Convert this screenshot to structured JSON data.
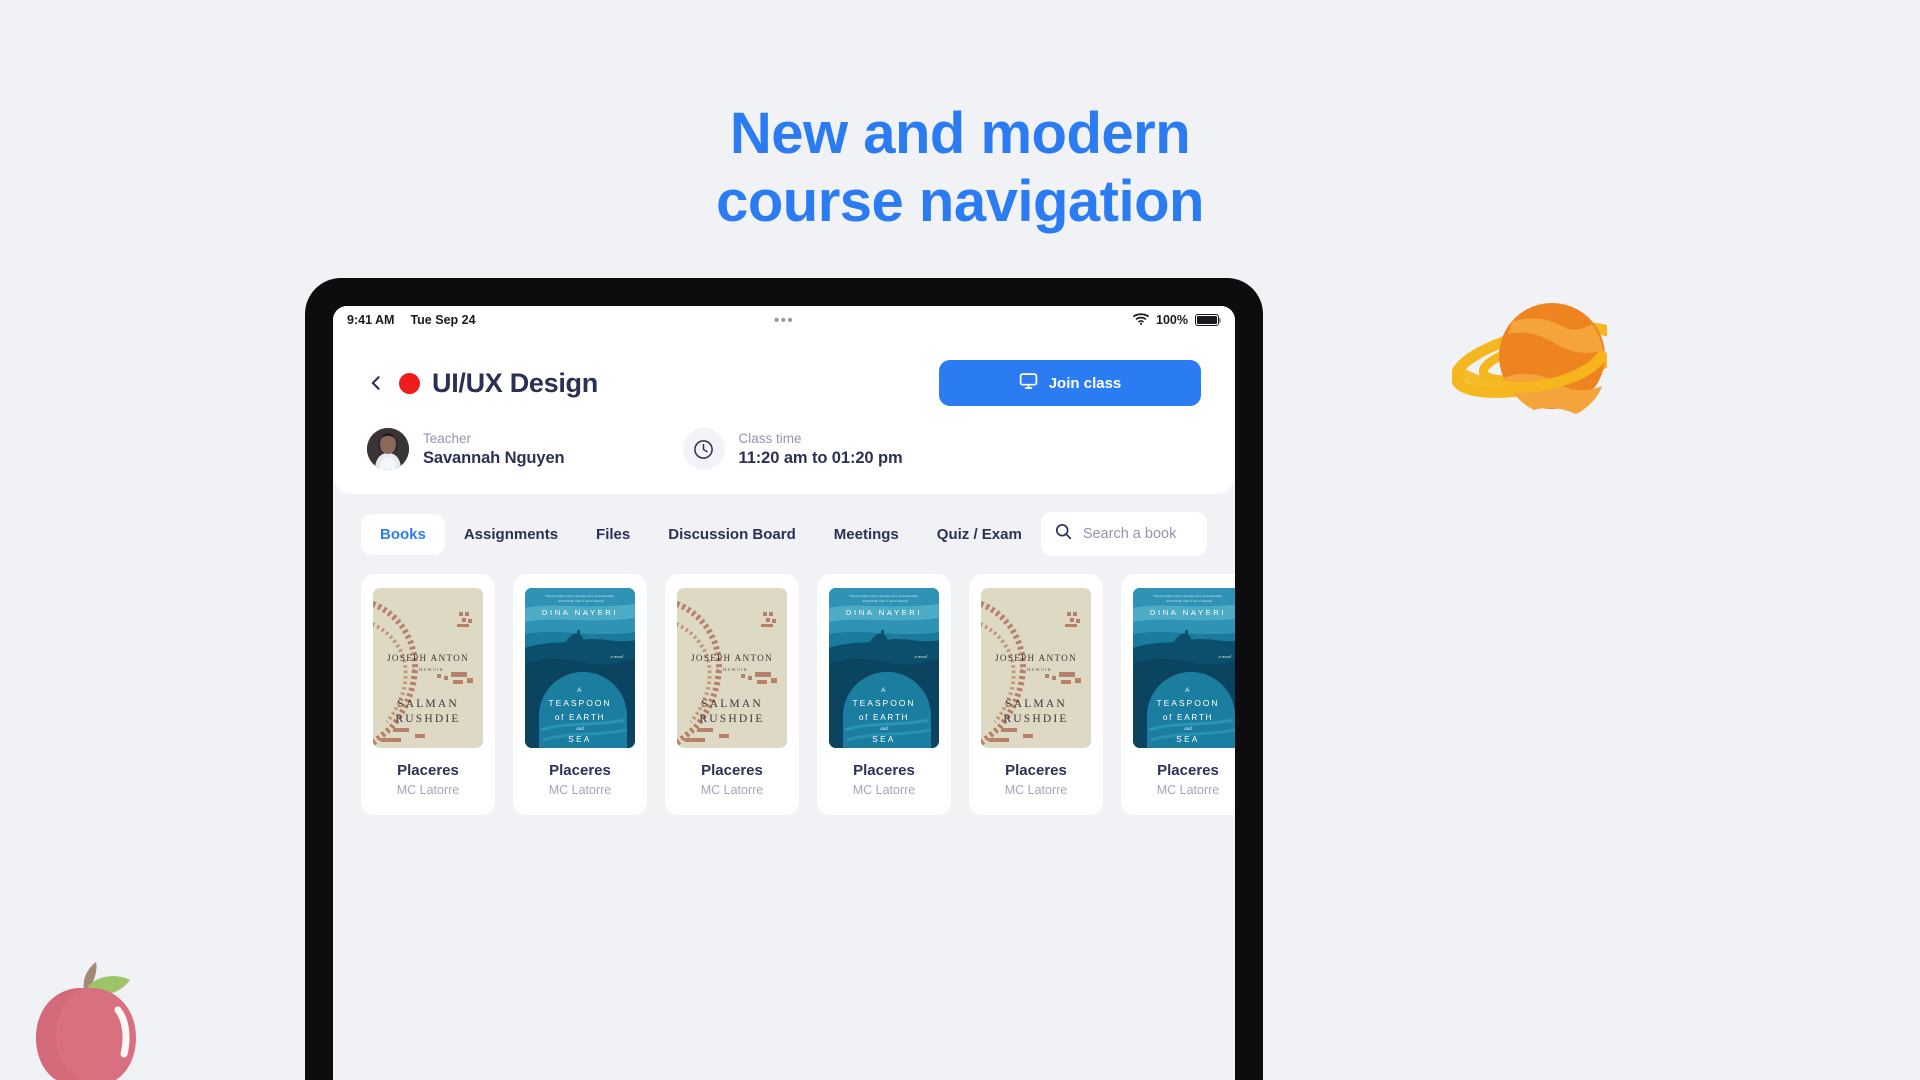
{
  "headline": {
    "line1": "New and modern",
    "line2": "course navigation",
    "color": "#2b7bf3"
  },
  "statusbar": {
    "time": "9:41 AM",
    "date": "Tue Sep 24",
    "dots": "•••",
    "wifi_icon": "wifi-icon",
    "battery_percent": "100%",
    "battery_icon": "battery-full-icon"
  },
  "course": {
    "back_icon": "chevron-left-icon",
    "status_dot_color": "#f01c1c",
    "title": "UI/UX Design",
    "join_button": {
      "label": "Join class",
      "icon": "presentation-screen-icon",
      "color": "#2b7bf3"
    },
    "teacher": {
      "label": "Teacher",
      "name": "Savannah Nguyen",
      "avatar": "teacher-avatar"
    },
    "class_time": {
      "label": "Class time",
      "icon": "clock-icon",
      "value": "11:20 am  to  01:20 pm"
    }
  },
  "tabs": [
    {
      "label": "Books",
      "active": true
    },
    {
      "label": "Assignments",
      "active": false
    },
    {
      "label": "Files",
      "active": false
    },
    {
      "label": "Discussion Board",
      "active": false
    },
    {
      "label": "Meetings",
      "active": false
    },
    {
      "label": "Quiz / Exam",
      "active": false
    }
  ],
  "search": {
    "icon": "search-icon",
    "placeholder": "Search a book",
    "value": ""
  },
  "books": [
    {
      "title": "Placeres",
      "author": "MC Latorre",
      "cover": {
        "style": "joseph-anton",
        "author_line": "JOSEPH ANTON",
        "subtitle": "A MEMOIR",
        "name_line1": "SALMAN",
        "name_line2": "RUSHDIE"
      }
    },
    {
      "title": "Placeres",
      "author": "MC Latorre",
      "cover": {
        "style": "teaspoon",
        "author_line": "DINA NAYERI",
        "t1": "A",
        "t2": "TEASPOON",
        "t3": "of EARTH",
        "t4": "and",
        "t5": "SEA"
      }
    },
    {
      "title": "Placeres",
      "author": "MC Latorre",
      "cover": {
        "style": "joseph-anton",
        "author_line": "JOSEPH ANTON",
        "subtitle": "A MEMOIR",
        "name_line1": "SALMAN",
        "name_line2": "RUSHDIE"
      }
    },
    {
      "title": "Placeres",
      "author": "MC Latorre",
      "cover": {
        "style": "teaspoon",
        "author_line": "DINA NAYERI",
        "t1": "A",
        "t2": "TEASPOON",
        "t3": "of EARTH",
        "t4": "and",
        "t5": "SEA"
      }
    },
    {
      "title": "Placeres",
      "author": "MC Latorre",
      "cover": {
        "style": "joseph-anton",
        "author_line": "JOSEPH ANTON",
        "subtitle": "A MEMOIR",
        "name_line1": "SALMAN",
        "name_line2": "RUSHDIE"
      }
    },
    {
      "title": "Placeres",
      "author": "MC Latorre",
      "cover": {
        "style": "teaspoon",
        "author_line": "DINA NAYERI",
        "t1": "A",
        "t2": "TEASPOON",
        "t3": "of EARTH",
        "t4": "and",
        "t5": "SEA"
      }
    }
  ],
  "decor": {
    "apple": "apple-illustration",
    "planet": "saturn-planet-illustration"
  }
}
